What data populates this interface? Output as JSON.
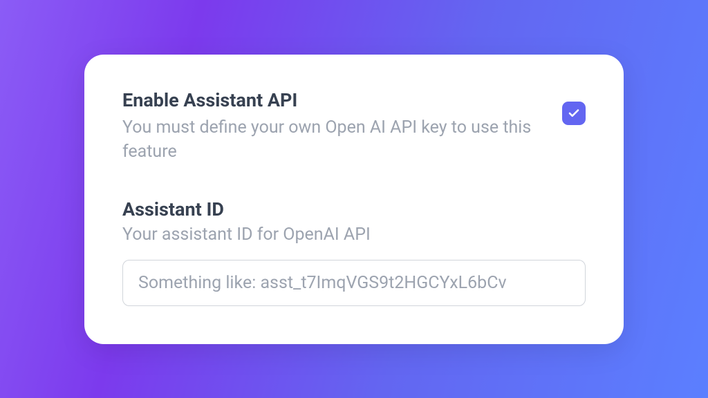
{
  "enable_section": {
    "title": "Enable Assistant API",
    "description": "You must define your own Open AI API key to use this feature",
    "checked": true
  },
  "assistant_id_section": {
    "title": "Assistant ID",
    "description": "Your assistant ID for OpenAI API",
    "placeholder": "Something like: asst_t7ImqVGS9t2HGCYxL6bCv",
    "value": ""
  }
}
